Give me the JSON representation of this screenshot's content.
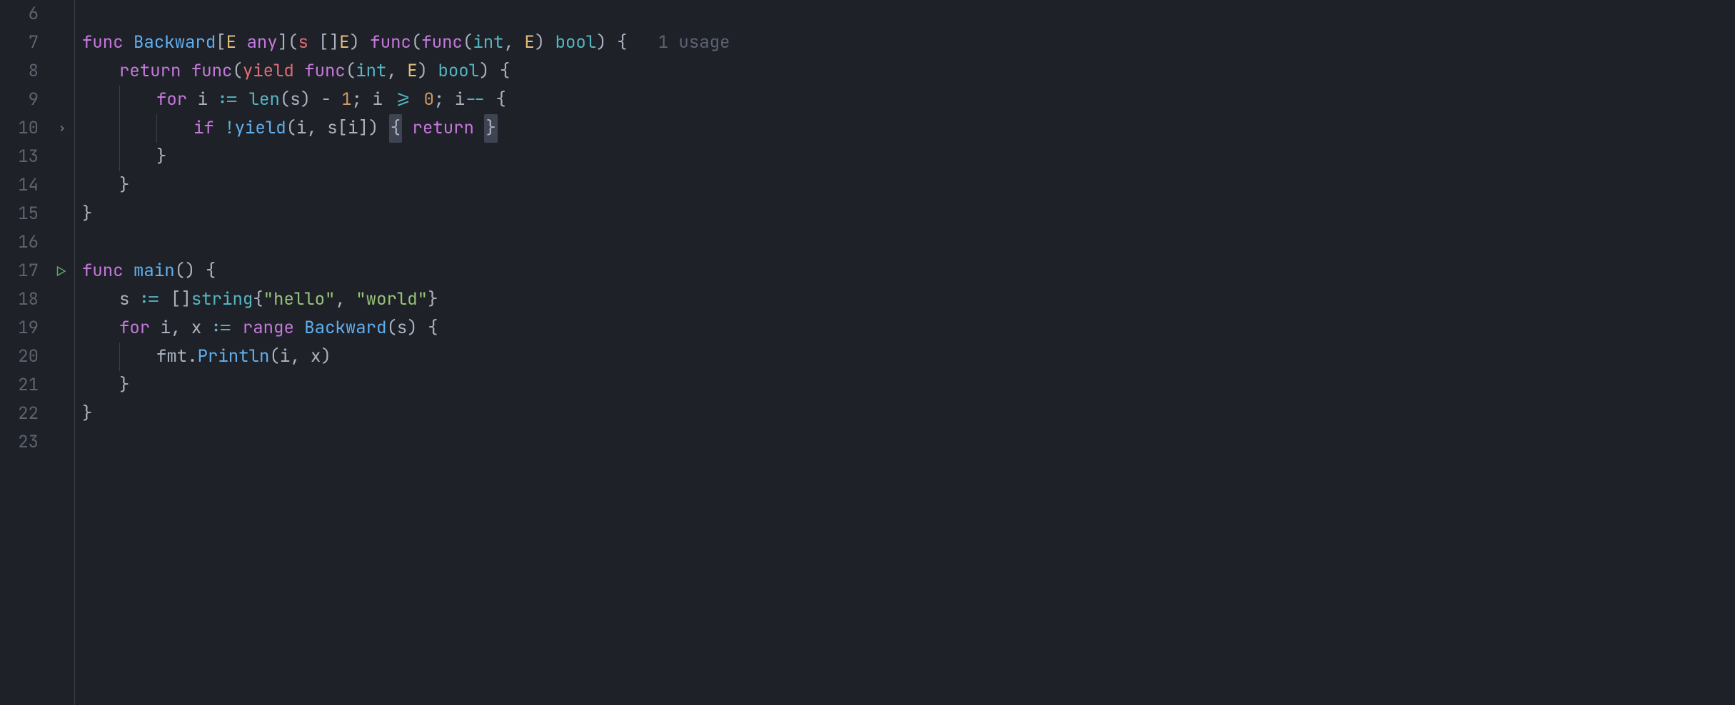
{
  "gutter": {
    "lines": [
      "6",
      "7",
      "8",
      "9",
      "10",
      "13",
      "14",
      "15",
      "16",
      "17",
      "18",
      "19",
      "20",
      "21",
      "22",
      "23"
    ],
    "fold_row_index": 4,
    "run_row_index": 9
  },
  "hint": {
    "usages": "1 usage"
  },
  "code": {
    "l7": {
      "kw_func": "func",
      "fn": "Backward",
      "lb": "[",
      "tp_E": "E",
      "kw_any": "any",
      "rb": "]",
      "lp": "(",
      "p_s": "s",
      "sl": "[]",
      "tp_E2": "E",
      "rp": ")",
      "kw_func2": "func",
      "lp2": "(",
      "kw_func3": "func",
      "lp3": "(",
      "tp_int": "int",
      "comma": ", ",
      "tp_E3": "E",
      "rp3": ")",
      "tp_bool": "bool",
      "rp2": ")",
      "ob": "{"
    },
    "l8": {
      "kw_return": "return",
      "kw_func": "func",
      "lp": "(",
      "p_yield": "yield",
      "kw_func2": "func",
      "lp2": "(",
      "tp_int": "int",
      "comma": ", ",
      "tp_E": "E",
      "rp2": ")",
      "tp_bool": "bool",
      "rp": ")",
      "ob": "{"
    },
    "l9": {
      "kw_for": "for",
      "v_i": "i",
      "op_decl": ":=",
      "fn_len": "len",
      "lp": "(",
      "v_s": "s",
      "rp": ")",
      "minus": " - ",
      "n_1": "1",
      "semi1": "; ",
      "v_i2": "i",
      "op_ge": ">=",
      "n_0": "0",
      "semi2": "; ",
      "v_i3": "i",
      "op_dec": "--",
      "ob": "{"
    },
    "l10": {
      "kw_if": "if",
      "op_not": "!",
      "fn_yield": "yield",
      "lp": "(",
      "v_i": "i",
      "comma": ", ",
      "v_s": "s",
      "lb": "[",
      "v_i2": "i",
      "rb": "]",
      "rp": ")",
      "ob": "{",
      "kw_return": "return",
      "cb": "}"
    },
    "l13": {
      "cb": "}"
    },
    "l14": {
      "cb": "}"
    },
    "l15": {
      "cb": "}"
    },
    "l17": {
      "kw_func": "func",
      "fn": "main",
      "lp": "(",
      "rp": ")",
      "ob": "{"
    },
    "l18": {
      "v_s": "s",
      "op_decl": ":=",
      "sl": "[]",
      "tp_str": "string",
      "ob": "{",
      "s1": "\"hello\"",
      "comma": ", ",
      "s2": "\"world\"",
      "cb": "}"
    },
    "l19": {
      "kw_for": "for",
      "v_i": "i",
      "comma": ", ",
      "v_x": "x",
      "op_decl": ":=",
      "kw_range": "range",
      "fn": "Backward",
      "lp": "(",
      "v_s": "s",
      "rp": ")",
      "ob": "{"
    },
    "l20": {
      "pkg": "fmt",
      "dot": ".",
      "fn": "Println",
      "lp": "(",
      "v_i": "i",
      "comma": ", ",
      "v_x": "x",
      "rp": ")"
    },
    "l21": {
      "cb": "}"
    },
    "l22": {
      "cb": "}"
    }
  }
}
